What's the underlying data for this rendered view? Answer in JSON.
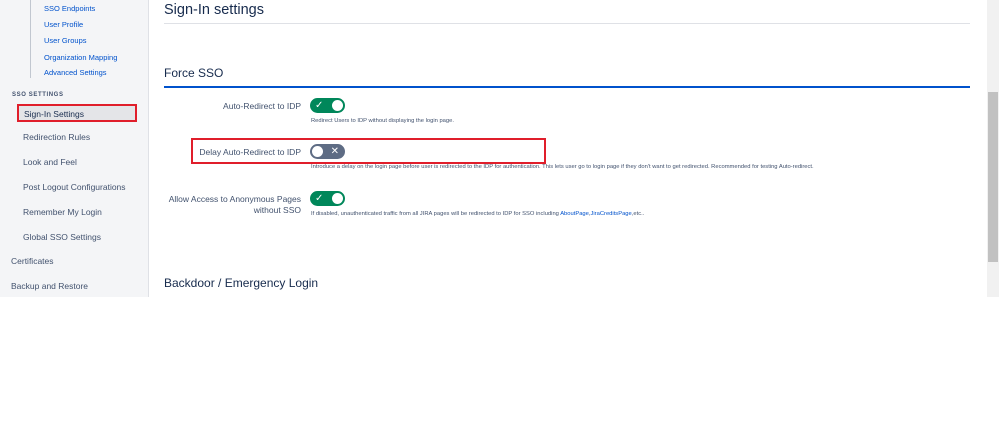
{
  "sidebar": {
    "sub_items": [
      "SSO Endpoints",
      "User Profile",
      "User Groups",
      "Organization Mapping",
      "Advanced Settings"
    ],
    "section_title": "SSO SETTINGS",
    "items": [
      "Sign-In Settings",
      "Redirection Rules",
      "Look and Feel",
      "Post Logout Configurations",
      "Remember My Login",
      "Global SSO Settings"
    ],
    "bottom_items": [
      "Certificates",
      "Backup and Restore"
    ]
  },
  "main": {
    "title": "Sign-In settings",
    "force_sso": {
      "heading": "Force SSO",
      "fields": [
        {
          "label": "Auto-Redirect to IDP",
          "state": "on",
          "help": "Redirect Users to IDP without displaying the login page."
        },
        {
          "label": "Delay Auto-Redirect to IDP",
          "state": "off",
          "help": "Introduce a delay on the login page before user is redirected to the IDP for authentication. This lets user go to login page if they don't want to get redirected. Recommended for testing Auto-redirect."
        },
        {
          "label": "Allow Access to Anonymous Pages without SSO",
          "state": "on",
          "help_prefix": "If disabled, unauthenticated traffic from all JIRA pages will be redirected to IDP for SSO including ",
          "help_link1": "AboutPage",
          "help_sep": ",",
          "help_link2": "JiraCreditsPage",
          "help_suffix": ",etc.."
        }
      ]
    },
    "backdoor_heading": "Backdoor / Emergency Login"
  },
  "icons": {
    "toggle_on": "check-icon",
    "toggle_off": "x-icon"
  },
  "colors": {
    "toggle_on": "#00875a",
    "toggle_off": "#5e6c84",
    "link": "#0052cc",
    "section_rule": "#0052cc",
    "highlight": "#e01e2b"
  }
}
